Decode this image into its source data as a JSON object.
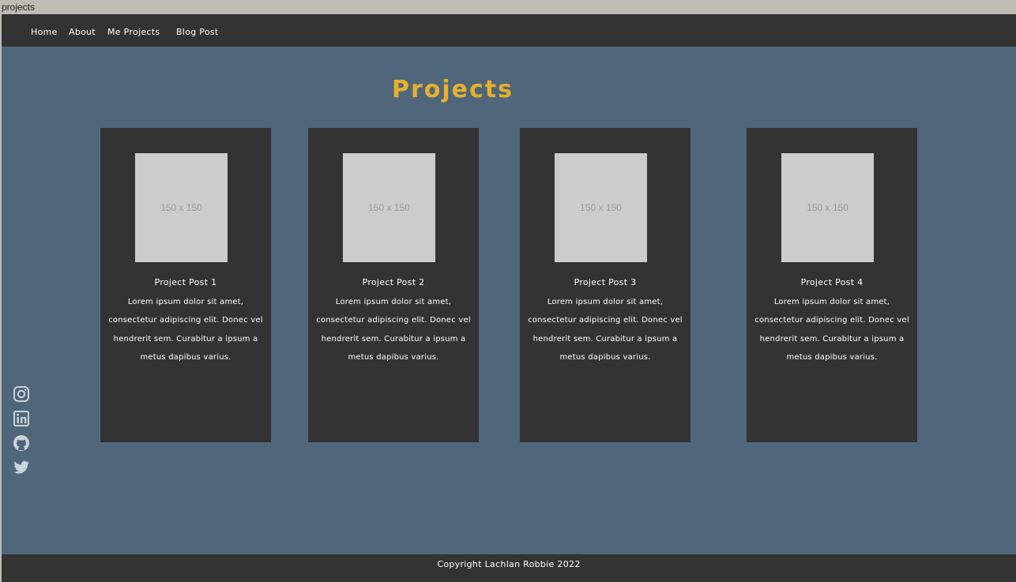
{
  "window": {
    "title": "projects"
  },
  "nav": {
    "links": [
      {
        "label": "Home"
      },
      {
        "label": "About"
      },
      {
        "label": "Me Projects"
      },
      {
        "label": "Blog Post"
      }
    ]
  },
  "main": {
    "title": "Projects",
    "cards": [
      {
        "image_text": "150 x 150",
        "title": "Project Post 1",
        "text": "Lorem ipsum dolor sit amet, consectetur adipiscing elit. Donec vel hendrerit sem. Curabitur a ipsum a metus dapibus varius."
      },
      {
        "image_text": "150 x 150",
        "title": "Project Post 2",
        "text": "Lorem ipsum dolor sit amet, consectetur adipiscing elit. Donec vel hendrerit sem. Curabitur a ipsum a metus dapibus varius."
      },
      {
        "image_text": "150 x 150",
        "title": "Project Post 3",
        "text": "Lorem ipsum dolor sit amet, consectetur adipiscing elit. Donec vel hendrerit sem. Curabitur a ipsum a metus dapibus varius."
      },
      {
        "image_text": "150 x 150",
        "title": "Project Post 4",
        "text": "Lorem ipsum dolor sit amet, consectetur adipiscing elit. Donec vel hendrerit sem. Curabitur a ipsum a metus dapibus varius."
      }
    ]
  },
  "socials": {
    "icons": [
      "instagram-icon",
      "linkedin-icon",
      "github-icon",
      "twitter-icon"
    ],
    "color": "#c9d3dc"
  },
  "footer": {
    "text": "Copyright Lachlan Robbie 2022"
  },
  "colors": {
    "page_background": "#50667a",
    "bar_background": "#333333",
    "title_accent": "#e6b02e",
    "placeholder": "#cccccc"
  }
}
